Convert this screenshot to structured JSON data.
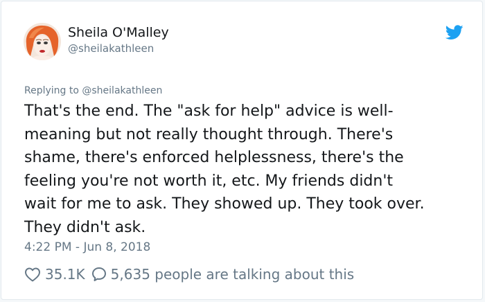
{
  "author": {
    "name": "Sheila O'Malley",
    "handle": "@sheilakathleen",
    "avatar_icon": "profile-photo"
  },
  "brand": {
    "icon": "twitter-bird-icon",
    "color": "#1da1f2"
  },
  "reply": {
    "prefix": "Replying to",
    "handle": "@sheilakathleen"
  },
  "tweet": {
    "lines": [
      "That's the end. The \"ask for help\" advice is well-",
      "meaning but not really thought through. There's",
      "shame, there's enforced helplessness, there's the",
      "feeling you're not worth it, etc. My friends didn't",
      "wait for me to ask. They showed up. They took over.",
      "They didn't ask."
    ],
    "timestamp": "4:22 PM - Jun 8, 2018"
  },
  "stats": {
    "like_icon": "heart-icon",
    "likes": "35.1K",
    "talk_icon": "speech-bubble-icon",
    "talking": "5,635 people are talking about this"
  },
  "colors": {
    "text": "#14171a",
    "secondary": "#657786",
    "border": "#e1e8ed"
  }
}
